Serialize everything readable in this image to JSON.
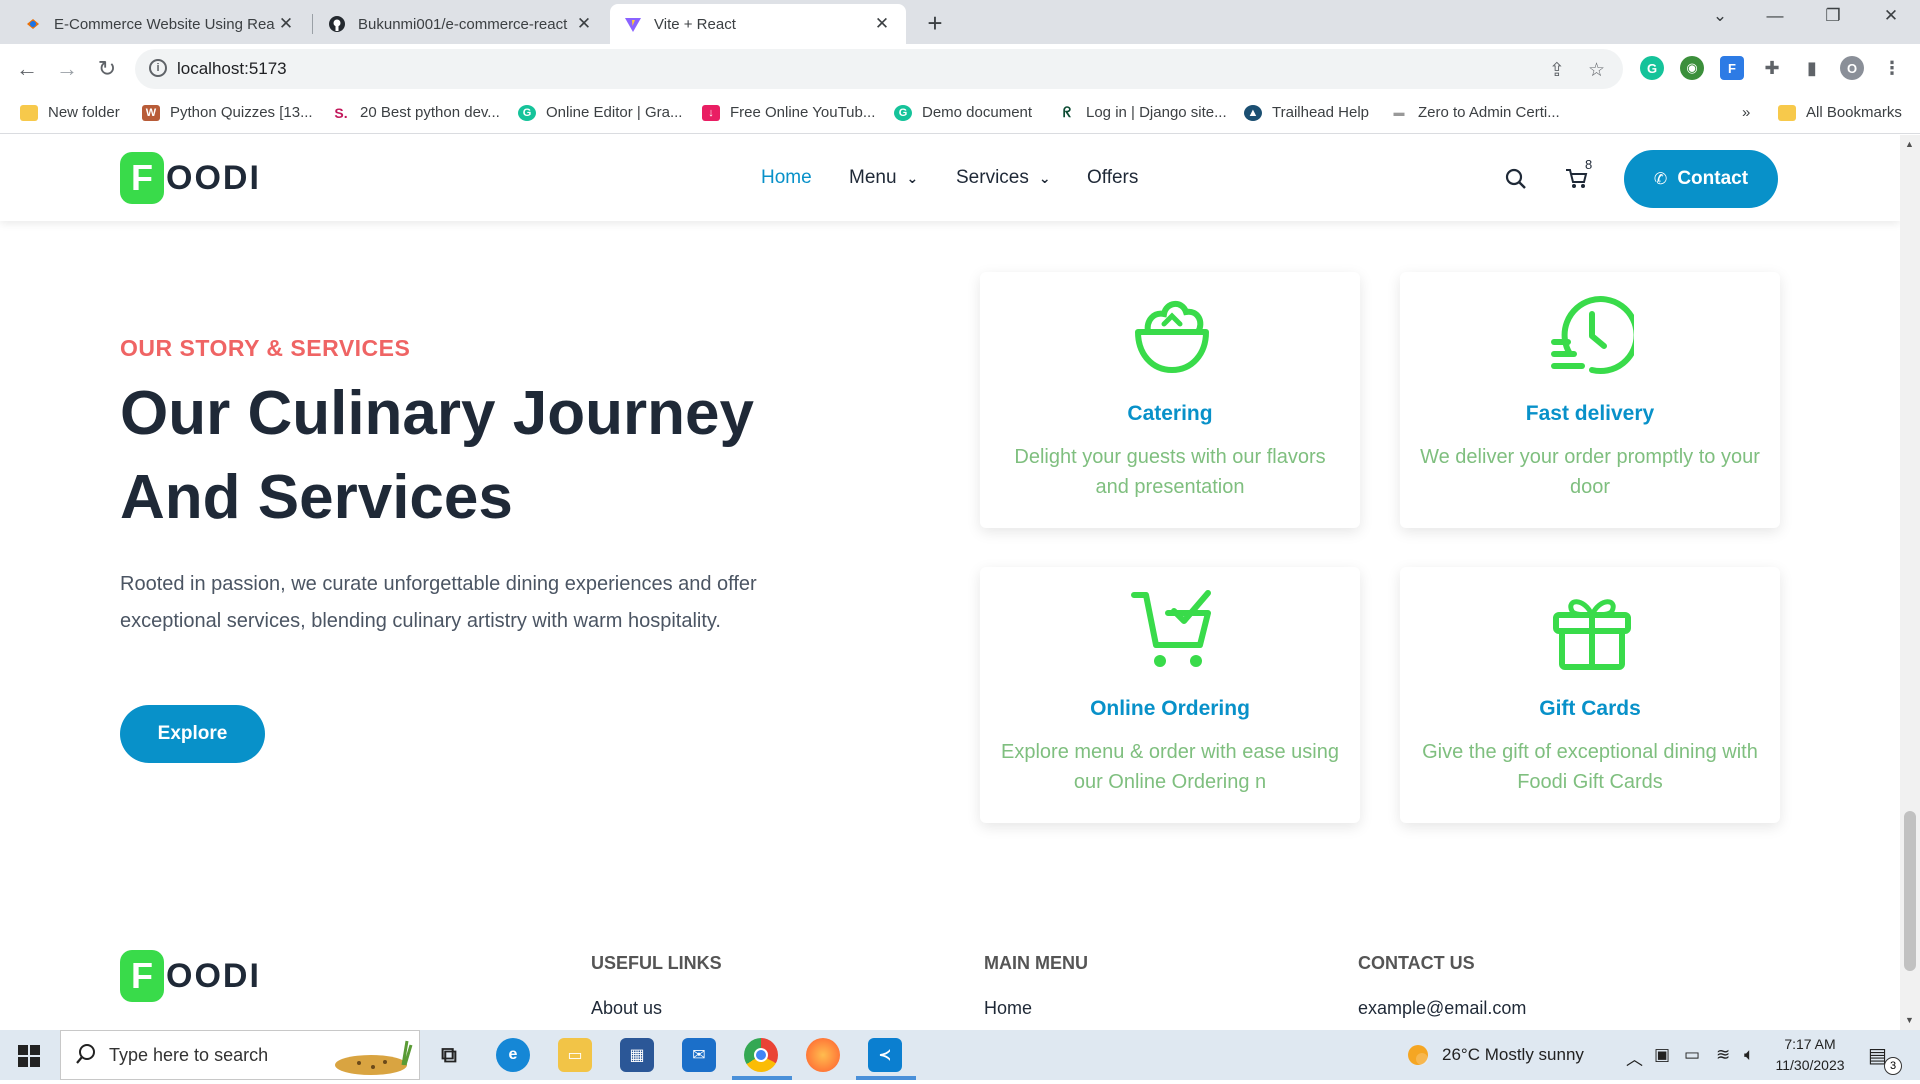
{
  "browser": {
    "tabs": [
      {
        "title": "E-Commerce Website Using Rea",
        "icon": "webpage-icon"
      },
      {
        "title": "Bukunmi001/e-commerce-react",
        "icon": "github-icon"
      },
      {
        "title": "Vite + React",
        "icon": "vite-icon"
      }
    ],
    "url": "localhost:5173",
    "bookmarks": [
      {
        "label": "New folder"
      },
      {
        "label": "Python Quizzes [13..."
      },
      {
        "label": "20 Best python dev..."
      },
      {
        "label": "Online Editor | Gra..."
      },
      {
        "label": "Free Online YouTub..."
      },
      {
        "label": "Demo document"
      },
      {
        "label": "Log in | Django site..."
      },
      {
        "label": "Trailhead Help"
      },
      {
        "label": "Zero to Admin Certi..."
      }
    ],
    "bookmarks_overflow": "»",
    "all_bookmarks": "All Bookmarks",
    "profile_initial": "O"
  },
  "site": {
    "logo_letter": "F",
    "logo_rest": "OODI",
    "nav": {
      "home": "Home",
      "menu": "Menu",
      "services": "Services",
      "offers": "Offers"
    },
    "cart_count": "8",
    "contact_label": "Contact",
    "colors": {
      "accent": "#0891c9",
      "brand_green": "#39db4a",
      "eyebrow": "#ef6464",
      "card_text": "#7fbf7f"
    }
  },
  "hero": {
    "eyebrow": "OUR STORY & SERVICES",
    "headline": "Our Culinary Journey And Services",
    "lead": "Rooted in passion, we curate unforgettable dining experiences and offer exceptional services, blending culinary artistry with warm hospitality.",
    "cta": "Explore"
  },
  "services": [
    {
      "title": "Catering",
      "desc": "Delight your guests with our flavors and presentation",
      "icon": "salad-bowl-icon"
    },
    {
      "title": "Fast delivery",
      "desc": "We deliver your order promptly to your door",
      "icon": "fast-clock-icon"
    },
    {
      "title": "Online Ordering",
      "desc": "Explore menu & order with ease using our Online Ordering n",
      "icon": "cart-check-icon"
    },
    {
      "title": "Gift Cards",
      "desc": "Give the gift of exceptional dining with Foodi Gift Cards",
      "icon": "gift-icon"
    }
  ],
  "footer": {
    "useful_links": {
      "heading": "USEFUL LINKS",
      "first": "About us"
    },
    "main_menu": {
      "heading": "MAIN MENU",
      "first": "Home"
    },
    "contact_us": {
      "heading": "CONTACT US",
      "first": "example@email.com"
    }
  },
  "taskbar": {
    "search_placeholder": "Type here to search",
    "weather": "26°C  Mostly sunny",
    "time": "7:17 AM",
    "date": "11/30/2023",
    "notifications": "3"
  }
}
